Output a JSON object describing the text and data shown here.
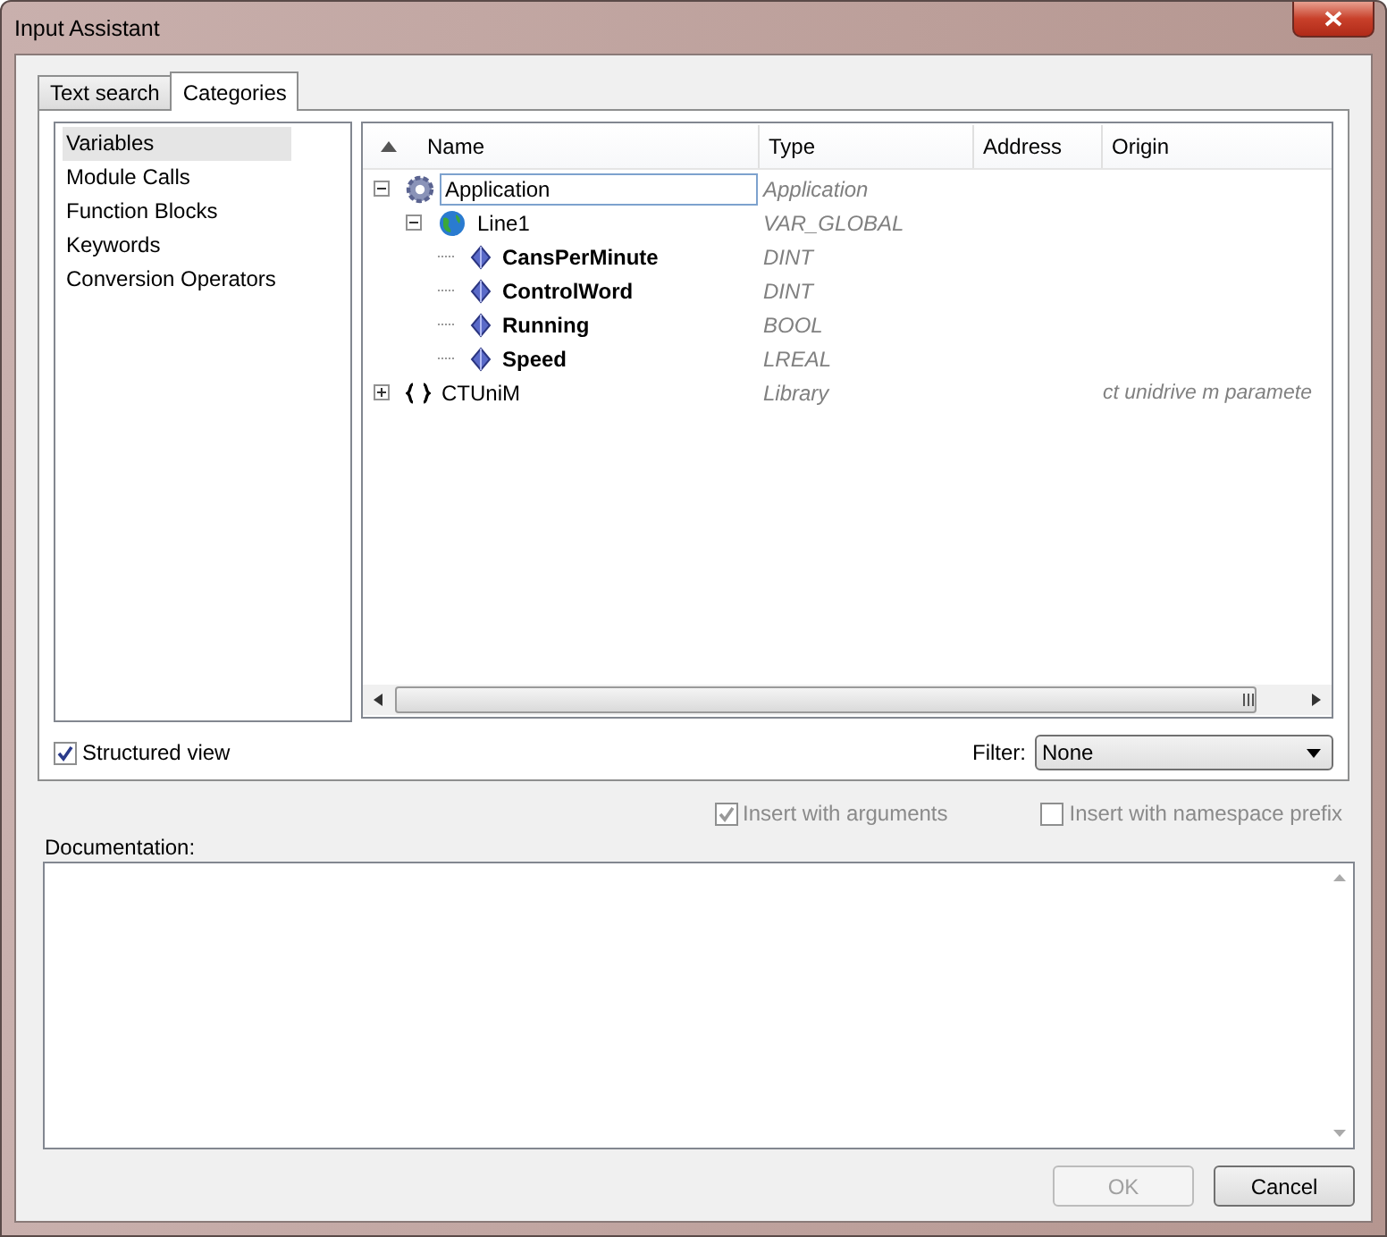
{
  "window": {
    "title": "Input Assistant"
  },
  "tabs": [
    {
      "label": "Text search",
      "selected": false
    },
    {
      "label": "Categories",
      "selected": true
    }
  ],
  "categories": [
    {
      "label": "Variables",
      "selected": true
    },
    {
      "label": "Module Calls",
      "selected": false
    },
    {
      "label": "Function Blocks",
      "selected": false
    },
    {
      "label": "Keywords",
      "selected": false
    },
    {
      "label": "Conversion Operators",
      "selected": false
    }
  ],
  "tree": {
    "columns": [
      {
        "label": "Name",
        "sorted": true
      },
      {
        "label": "Type",
        "sorted": false
      },
      {
        "label": "Address",
        "sorted": false
      },
      {
        "label": "Origin",
        "sorted": false
      }
    ],
    "rows": [
      {
        "name": "Application",
        "type": "Application",
        "kind": "gear",
        "bold": false,
        "focused": true,
        "expanded": true,
        "children": [
          {
            "name": "Line1",
            "type": "VAR_GLOBAL",
            "kind": "globe",
            "bold": false,
            "focused": false,
            "expanded": true,
            "children": [
              {
                "name": "CansPerMinute",
                "type": "DINT",
                "kind": "diamond",
                "bold": true,
                "focused": false
              },
              {
                "name": "ControlWord",
                "type": "DINT",
                "kind": "diamond",
                "bold": true,
                "focused": false
              },
              {
                "name": "Running",
                "type": "BOOL",
                "kind": "diamond",
                "bold": true,
                "focused": false
              },
              {
                "name": "Speed",
                "type": "LREAL",
                "kind": "diamond",
                "bold": true,
                "focused": false
              }
            ]
          }
        ]
      },
      {
        "name": "CTUniM",
        "type": "Library",
        "origin": "ct unidrive m paramete",
        "kind": "braces",
        "bold": false,
        "focused": false,
        "expanded": false
      }
    ]
  },
  "structured_view": {
    "label": "Structured view",
    "checked": true,
    "disabled": false
  },
  "filter": {
    "label": "Filter:",
    "value": "None"
  },
  "options": [
    {
      "label": "Insert with arguments",
      "checked": true,
      "disabled": true
    },
    {
      "label": "Insert with namespace prefix",
      "checked": false,
      "disabled": true
    }
  ],
  "documentation": {
    "label": "Documentation:"
  },
  "buttons": [
    {
      "label": "OK",
      "disabled": true
    },
    {
      "label": "Cancel",
      "disabled": false
    }
  ]
}
